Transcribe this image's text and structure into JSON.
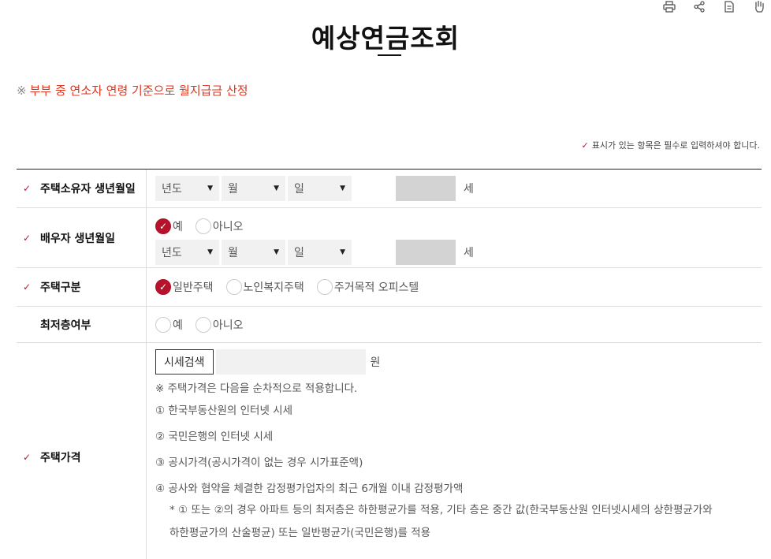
{
  "toolbar": {
    "icons": [
      "print-icon",
      "share-icon",
      "document-icon",
      "hand-icon"
    ]
  },
  "title": "예상연금조회",
  "notice": {
    "mark": "※",
    "text": "부부 중 연소자 연령 기준으로 월지급금 산정"
  },
  "required_note": "표시가 있는 항목은 필수로 입력하셔야 합니다.",
  "fields": {
    "owner_birth": {
      "label": "주택소유자 생년월일",
      "year": "년도",
      "month": "월",
      "day": "일",
      "age_unit": "세"
    },
    "spouse_birth": {
      "label": "배우자 생년월일",
      "yes": "예",
      "no": "아니오",
      "selected": "예",
      "year": "년도",
      "month": "월",
      "day": "일",
      "age_unit": "세"
    },
    "house_type": {
      "label": "주택구분",
      "options": [
        "일반주택",
        "노인복지주택",
        "주거목적 오피스텔"
      ],
      "selected": "일반주택"
    },
    "lowest_floor": {
      "label": "최저층여부",
      "yes": "예",
      "no": "아니오"
    },
    "house_price": {
      "label": "주택가격",
      "search_button": "시세검색",
      "unit": "원",
      "note": "※ 주택가격은 다음을 순차적으로 적용합니다.",
      "items": [
        "① 한국부동산원의 인터넷 시세",
        "② 국민은행의 인터넷 시세",
        "③ 공시가격(공시가격이 없는 경우 시가표준액)",
        "④ 공사와 협약을 체결한 감정평가업자의 최근 6개월 이내 감정평가액"
      ],
      "sub_note_line1": "* ① 또는 ②의 경우 아파트 등의 최저층은 하한평균가를 적용, 기타 층은 중간 값(한국부동산원 인터넷시세의 상한평균가와",
      "sub_note_line2": "하한평균가의 산술평균) 또는 일반평균가(국민은행)를 적용"
    }
  }
}
